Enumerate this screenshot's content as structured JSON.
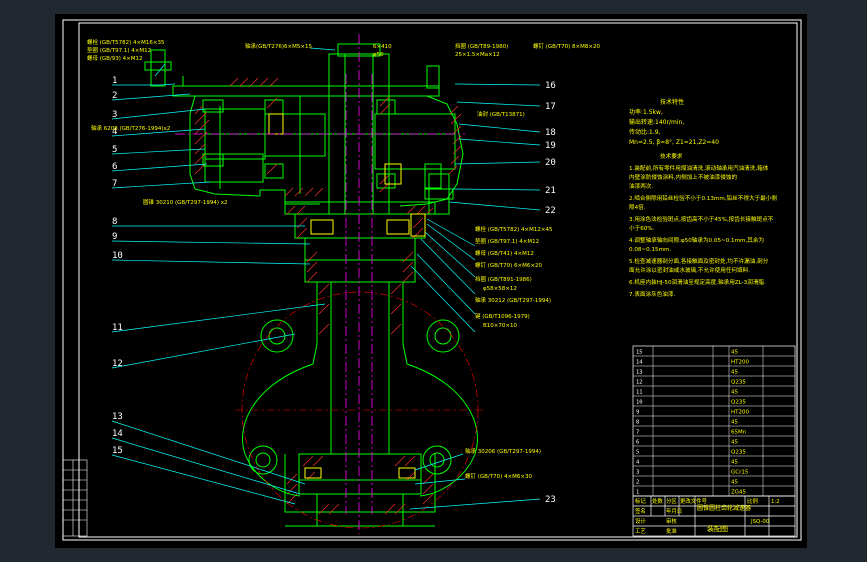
{
  "colors": {
    "background": "#212830",
    "sheet": "#000000",
    "frame": "#ffffff",
    "outline": "#00ff00",
    "leader": "#00ffff",
    "label": "#ffff00",
    "centerline": "#ff00ff",
    "hidden": "#ff0000",
    "hatch": "#ff3030"
  },
  "callouts_left": [
    "1",
    "2",
    "3",
    "4",
    "5",
    "6",
    "7",
    "8",
    "9",
    "10",
    "11",
    "12",
    "13",
    "14",
    "15"
  ],
  "callouts_right": [
    "16",
    "17",
    "18",
    "19",
    "20",
    "21",
    "22",
    "23"
  ],
  "annotations": {
    "top_left": [
      "螺栓 (GB/T5782) 4×M16×35",
      "垫圈 (GB/T97.1) 4×M12",
      "螺母 (GB/93) 4×M12"
    ],
    "top_center": "轴承(GB/T276)6×M5×15",
    "top_rv": "6×410",
    "top_fit": "φ50",
    "top_right_1": "挡圈 (GB/T89-1980)",
    "top_right_2": "25×1.5×Ma×12",
    "top_far_right": "螺钉 (GB/T70) 8×M8×20",
    "mid_left_bearing": "轴承 6208 (GB/T276-1994)x2",
    "mid_right_seal": "油封 (GB/T13871)",
    "lower_left_bearing": "圆锥 30210 (GB/T297-1994) x2",
    "right_stack": [
      "螺栓 (GB/T5782) 4×M12×45",
      "垫圈 (GB/T97.1) 4×M12",
      "螺母 (GB/T41) 4×M12",
      "螺钉 (GB/T70) 6×M6×20",
      "挡圈 (GB/T891-1986)",
      "φ58×58×12",
      "轴承 30212 (GB/T297-1994)",
      "键 (GB/T1096-1979)",
      "B10×70×10"
    ],
    "bottom_right_1": "轴承 30206 (GB/T297-1994)",
    "bottom_right_2": "螺钉 (GB/T70) 4×M6×30"
  },
  "tech_spec": {
    "title": "技术特性",
    "lines": [
      "功率:1.5kw,",
      "输出转速:140r/min,",
      "传动比:1.9,",
      "Mn=2.5, β=8°, Z1=21,Z2=40"
    ]
  },
  "tech_requirements": {
    "title": "技术要求",
    "lines": [
      "1.装配前,所有零件用煤油清洗,滚动轴承用汽油清洗,箱体",
      "  内壁涂防侵蚀涂料,内侧加上不被油漆侵蚀的",
      "  油漆两次.",
      "2.啮合侧隙用铅丝检验不小于0.13mm,铅丝不得大于最小侧",
      "  隙4倍.",
      "3.用涂色法检验斑点,按齿高不小于45%,按齿长接触斑点不",
      "  小于60%.",
      "4.调整轴承轴向间隙:φ50轴承为0.05~0.1mm,其余为",
      "  0.08~0.15mm.",
      "5.检查减速器剖分面,各接触面及密封处,均不许漏油,剖分",
      "  面允许涂以密封油或水玻璃,不允许使用任何填料.",
      "6.机座内装HJ-50润滑油至规定高度,轴承用ZL-3润滑脂.",
      "7.表面涂灰色油漆."
    ]
  },
  "parts_table": {
    "materials": [
      "45",
      "HT200",
      "45",
      "Q235",
      "45",
      "Q235",
      "HT200",
      "45",
      "65Mn",
      "45",
      "Q235",
      "45",
      "GCr15",
      "45",
      "ZG45"
    ],
    "notes": [
      "",
      "",
      "",
      "",
      "",
      "",
      "",
      "",
      "",
      "",
      "",
      "",
      "",
      "",
      ""
    ]
  },
  "title_block": {
    "product_name": "圆锥圆柱齿轮减速器",
    "drawing_type": "装配图",
    "scale_label": "比例",
    "scale": "1:2",
    "drawing_no": "JSQ-00",
    "header_cells": [
      "标记",
      "处数",
      "分区",
      "更改文件号",
      "签名",
      "年月日"
    ],
    "role_cells": [
      "设计",
      "审核",
      "工艺",
      "批准"
    ]
  }
}
